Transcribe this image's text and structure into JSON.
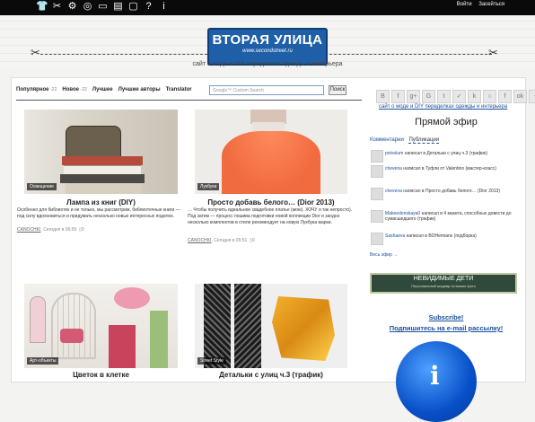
{
  "topbar": {
    "icons": [
      "shirt-icon",
      "scissors-icon",
      "sewing-machine-icon",
      "globe-icon",
      "iron-icon",
      "sewing-machine-2-icon",
      "speech-bubble-icon",
      "question-icon",
      "info-icon"
    ],
    "login": "Войти",
    "register": "Засейться"
  },
  "banner": {
    "logo_title": "ВТОРАЯ УЛИЦА",
    "logo_site": "www.secondstreet.ru",
    "tagline": "сайт о моде и DIY переделках одежды и интерьера"
  },
  "nav": {
    "items": [
      {
        "label": "Популярное",
        "suffix": "-22"
      },
      {
        "label": "Новое",
        "suffix": "-22"
      },
      {
        "label": "Лучшее",
        "suffix": ""
      },
      {
        "label": "Лучшие авторы",
        "suffix": ""
      },
      {
        "label": "Translator",
        "suffix": ""
      }
    ],
    "search_placeholder": "Google™ Custom Search",
    "search_button": "Поиск"
  },
  "posts": [
    {
      "tag": "Освещение",
      "title": "Лампа из книг (DIY)",
      "excerpt": "Особенно для библиотек и не только, мы рассмотрим, библиотечные книги — под силу вдохновиться и придумать несколько новых интересных поделок.",
      "author": "CANOCHKI",
      "date": "Сегодня в 06:55",
      "comments": "0"
    },
    {
      "tag": "Лукбуки",
      "title": "Просто добавь белого… (Dior 2013)",
      "excerpt": "… Чтобы получить идеальное свадебное платье (мою). ХОЧУ я так непросто). Под затем — процесс пошива подготовки новой коллекции Dior и заодно несколько комплектов в стиле рекомендует на новую Лукбука марки.",
      "author": "CANOCHKI",
      "date": "Сегодня в 05:51",
      "comments": "0"
    },
    {
      "tag": "Арт-объекты",
      "title": "Цветок в клетке",
      "excerpt": "",
      "author": "",
      "date": "",
      "comments": ""
    },
    {
      "tag": "Street Style",
      "title": "Детальки с улиц ч.3 (трафик)",
      "excerpt": "",
      "author": "",
      "date": "",
      "comments": ""
    }
  ],
  "sidebar": {
    "socials": [
      "B",
      "f",
      "g+",
      "G",
      "t",
      "✓",
      "k",
      "○",
      "f",
      "ok",
      "~"
    ],
    "site_link": "сайт о моде и DIY переделках одежды и интерьера",
    "live_title": "Прямой эфир",
    "tab_comments": "Комментарии",
    "tab_posts": "Публикации",
    "comments": [
      {
        "user": "potsolum",
        "text": "написал в Детальки с улиц ч.3 (трафик)"
      },
      {
        "user": "chevena",
        "text": "написал в Туфли от Valentino (мастер-класс)"
      },
      {
        "user": "chevena",
        "text": "написал в Просто добавь белого… (Dior 2013)"
      },
      {
        "user": "Makeedonskaya0",
        "text": "написал в 4 макета, способных довести до сумасшедшего (трафик)"
      },
      {
        "user": "Sashaeva",
        "text": "написал в BOHemians (подборка)"
      }
    ],
    "all_comments": "Весь эфир →",
    "ad_title": "НЕВИДИМЫЕ ДЕТИ",
    "ad_sub": "Персональный шедевр из ваших фото",
    "subscribe": "Subscribe!",
    "subscribe_email": "Подпишитесь на e-mail рассылку!"
  }
}
